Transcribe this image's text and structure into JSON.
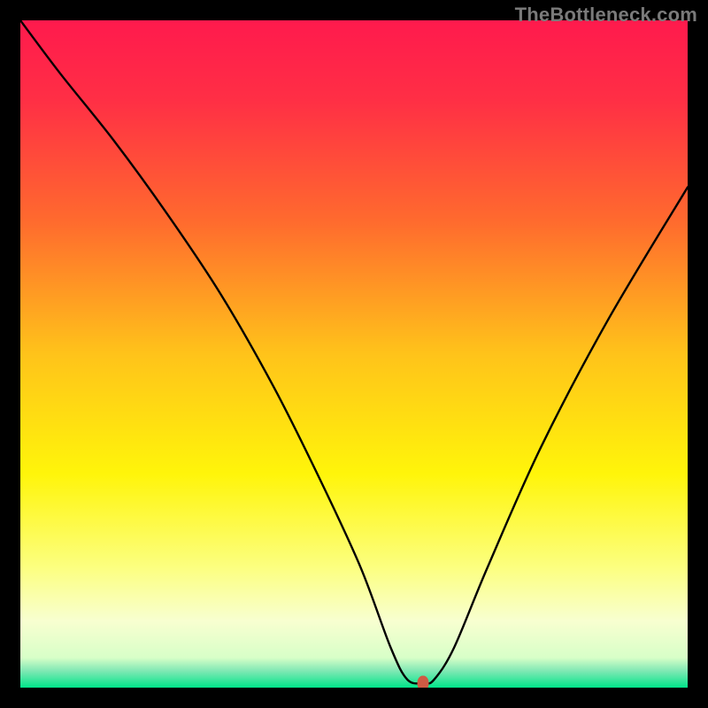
{
  "watermark": "TheBottleneck.com",
  "chart_data": {
    "type": "line",
    "title": "",
    "xlabel": "",
    "ylabel": "",
    "xlim": [
      0,
      100
    ],
    "ylim": [
      0,
      100
    ],
    "grid": false,
    "legend": false,
    "background_gradient_stops": [
      {
        "offset": 0.0,
        "color": "#ff1a4d"
      },
      {
        "offset": 0.12,
        "color": "#ff2f45"
      },
      {
        "offset": 0.3,
        "color": "#ff6a2e"
      },
      {
        "offset": 0.5,
        "color": "#ffc31a"
      },
      {
        "offset": 0.68,
        "color": "#fff50a"
      },
      {
        "offset": 0.82,
        "color": "#fcff80"
      },
      {
        "offset": 0.9,
        "color": "#f8ffd0"
      },
      {
        "offset": 0.955,
        "color": "#d8ffc8"
      },
      {
        "offset": 0.975,
        "color": "#7fe8b4"
      },
      {
        "offset": 1.0,
        "color": "#00e58a"
      }
    ],
    "series": [
      {
        "name": "bottleneck-curve",
        "x": [
          0,
          6,
          14,
          22,
          30,
          38,
          45,
          51,
          55.5,
          58.0,
          60.5,
          62.0,
          65,
          70,
          78,
          88,
          100
        ],
        "y": [
          100,
          92,
          82,
          71,
          59,
          45,
          31,
          18,
          6,
          1.2,
          0.7,
          1.2,
          6,
          18,
          36,
          55,
          75
        ]
      }
    ],
    "marker": {
      "x": 60.3,
      "y": 0.7,
      "color": "#cf5b44"
    }
  }
}
